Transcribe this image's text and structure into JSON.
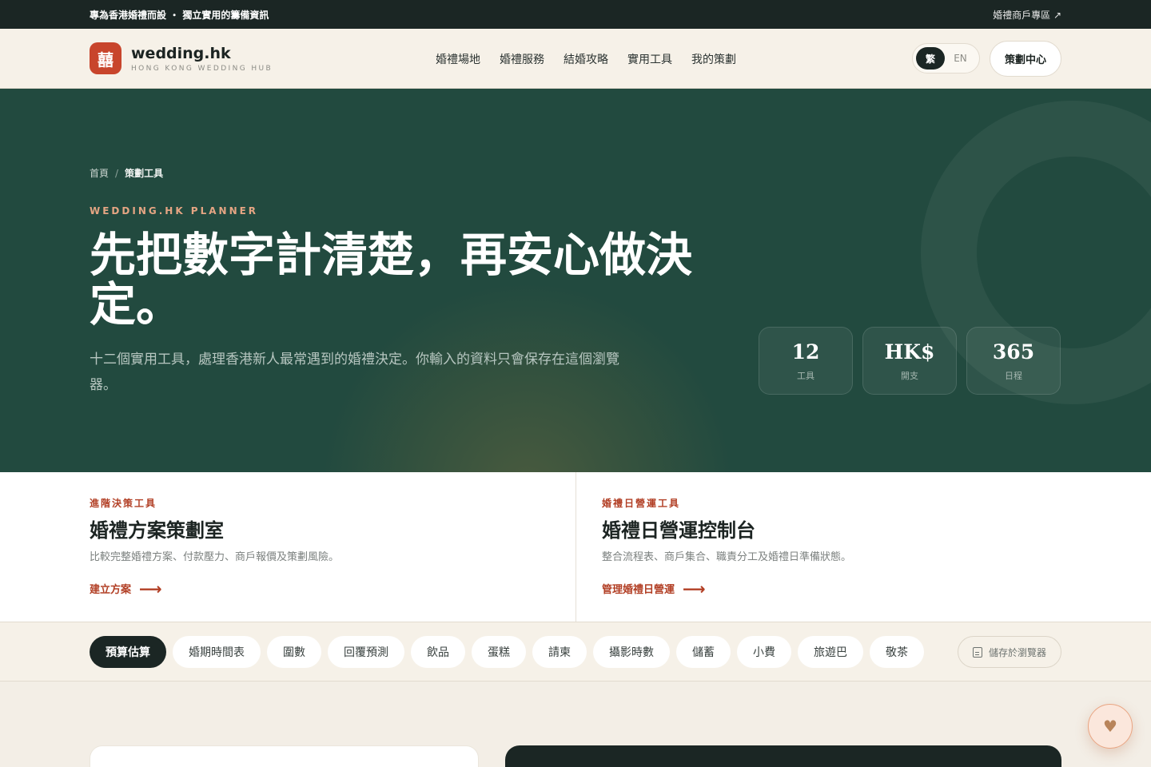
{
  "topbar": {
    "announcement": "專為香港婚禮而設 ・ 獨立實用的籌備資訊",
    "merchant_link": "婚禮商戶專區 ↗"
  },
  "header": {
    "logo_char": "囍",
    "brand": "wedding.hk",
    "tagline": "HONG KONG WEDDING HUB",
    "nav": [
      "婚禮場地",
      "婚禮服務",
      "結婚攻略",
      "實用工具",
      "我的策劃"
    ],
    "lang_active": "繁",
    "lang_other": "EN",
    "hub_button": "策劃中心"
  },
  "hero": {
    "breadcrumb_home": "首頁",
    "breadcrumb_sep": "/",
    "breadcrumb_current": "策劃工具",
    "eyebrow": "WEDDING.HK PLANNER",
    "title": "先把數字計清楚，再安心做決定。",
    "description": "十二個實用工具，處理香港新人最常遇到的婚禮決定。你輸入的資料只會保存在這個瀏覽器。",
    "stats": [
      {
        "value": "12",
        "label": "工具"
      },
      {
        "value": "HK$",
        "label": "開支"
      },
      {
        "value": "365",
        "label": "日程"
      }
    ]
  },
  "cards": [
    {
      "tag": "進階決策工具",
      "title": "婚禮方案策劃室",
      "subtitle": "比較完整婚禮方案、付款壓力、商戶報價及策劃風險。",
      "link": "建立方案",
      "arrow": "⟶"
    },
    {
      "tag": "婚禮日營運工具",
      "title": "婚禮日營運控制台",
      "subtitle": "整合流程表、商戶集合、職責分工及婚禮日準備狀態。",
      "link": "管理婚禮日營運",
      "arrow": "⟶"
    }
  ],
  "tabs": {
    "items": [
      "預算估算",
      "婚期時間表",
      "圍數",
      "回覆預測",
      "飲品",
      "蛋糕",
      "請柬",
      "攝影時數",
      "儲蓄",
      "小費",
      "旅遊巴",
      "敬茶"
    ],
    "active_index": 0,
    "save_label": "儲存於瀏覽器"
  },
  "floating": {
    "icon": "heart-icon",
    "glyph": "♥"
  },
  "colors": {
    "hero_bg": "#224a3f",
    "accent": "#b23f25",
    "dark": "#1b2624",
    "cream": "#f6f1e8"
  }
}
